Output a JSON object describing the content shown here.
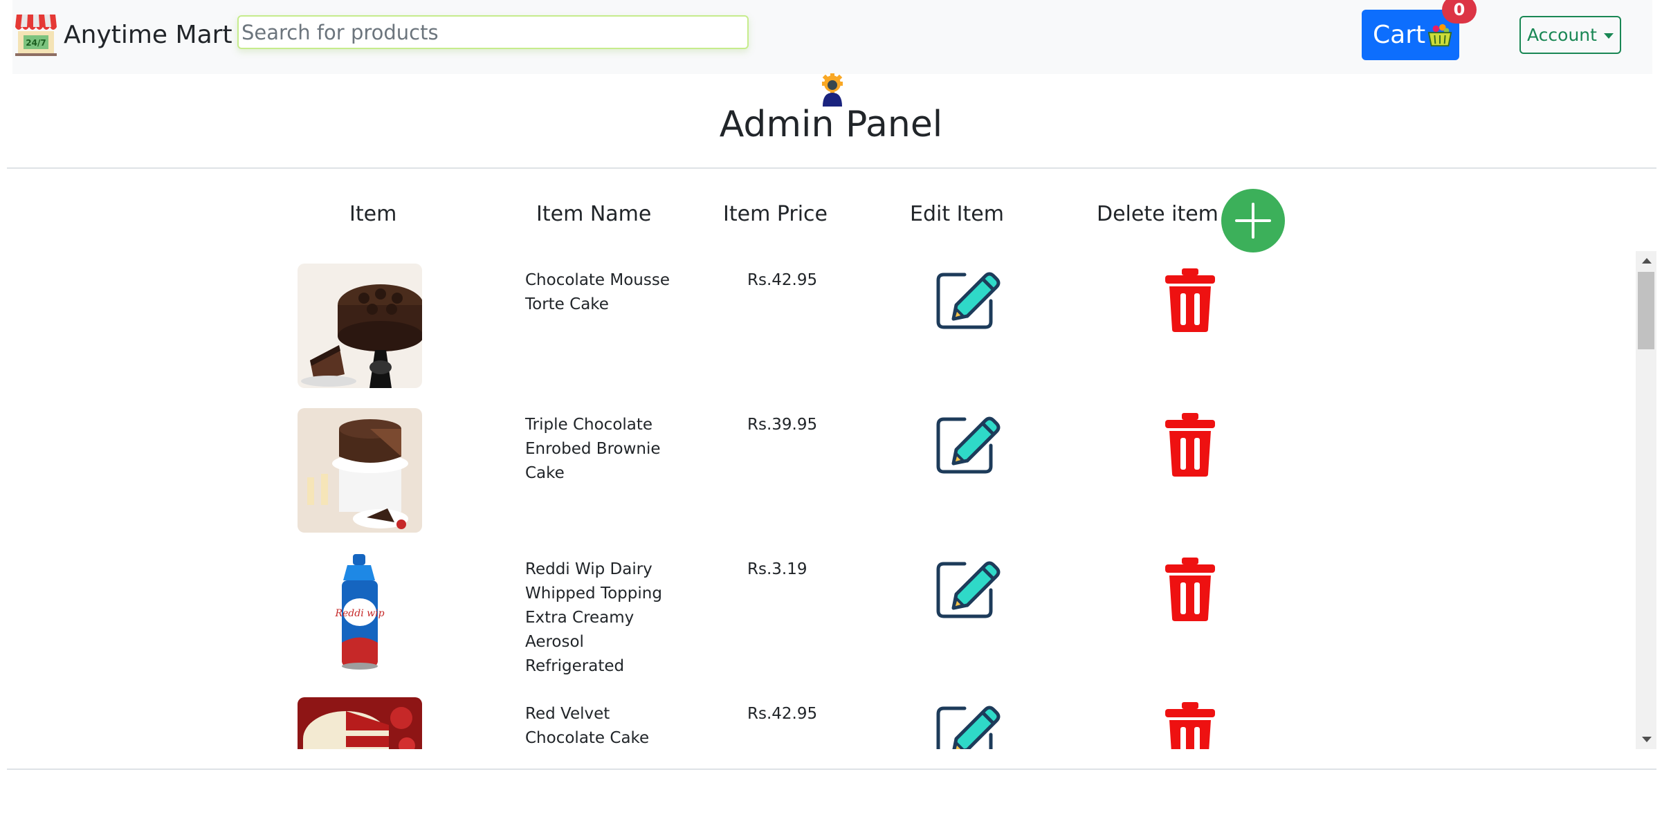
{
  "navbar": {
    "brand": "Anytime Mart",
    "brand_logo_text": "24/7",
    "search_placeholder": "Search for products",
    "cart_label": "Cart",
    "cart_count": "0",
    "account_label": "Account"
  },
  "page": {
    "title": "Admin Panel"
  },
  "table": {
    "headers": {
      "item": "Item",
      "name": "Item Name",
      "price": "Item Price",
      "edit": "Edit Item",
      "delete": "Delete item"
    },
    "rows": [
      {
        "name": "Chocolate Mousse Torte Cake",
        "price": "Rs.42.95",
        "image": "chocolate-mousse-torte-cake-image"
      },
      {
        "name": "Triple Chocolate Enrobed Brownie Cake",
        "price": "Rs.39.95",
        "image": "triple-chocolate-brownie-cake-image"
      },
      {
        "name": "Reddi Wip Dairy Whipped Topping Extra Creamy Aerosol Refrigerated",
        "price": "Rs.3.19",
        "image": "reddi-wip-can-image",
        "image_brand_text": "Reddi wip"
      },
      {
        "name": "Red Velvet Chocolate Cake",
        "price": "Rs.42.95",
        "image": "red-velvet-cake-image"
      }
    ]
  },
  "colors": {
    "navbar_bg": "#f8f9fa",
    "cart_button": "#0d6efd",
    "badge": "#dc3545",
    "account_outline": "#198754",
    "add_button": "#3cb05a",
    "delete_icon": "#ee1111",
    "edit_icon_fill": "#2fd9c8",
    "edit_icon_outline": "#1d3b5a"
  },
  "icons": {
    "logo": "store-247-icon",
    "cart": "basket-icon",
    "account_caret": "caret-down-icon",
    "admin": "admin-user-gear-icon",
    "add": "plus-icon",
    "edit": "edit-pencil-icon",
    "delete": "trash-icon"
  }
}
